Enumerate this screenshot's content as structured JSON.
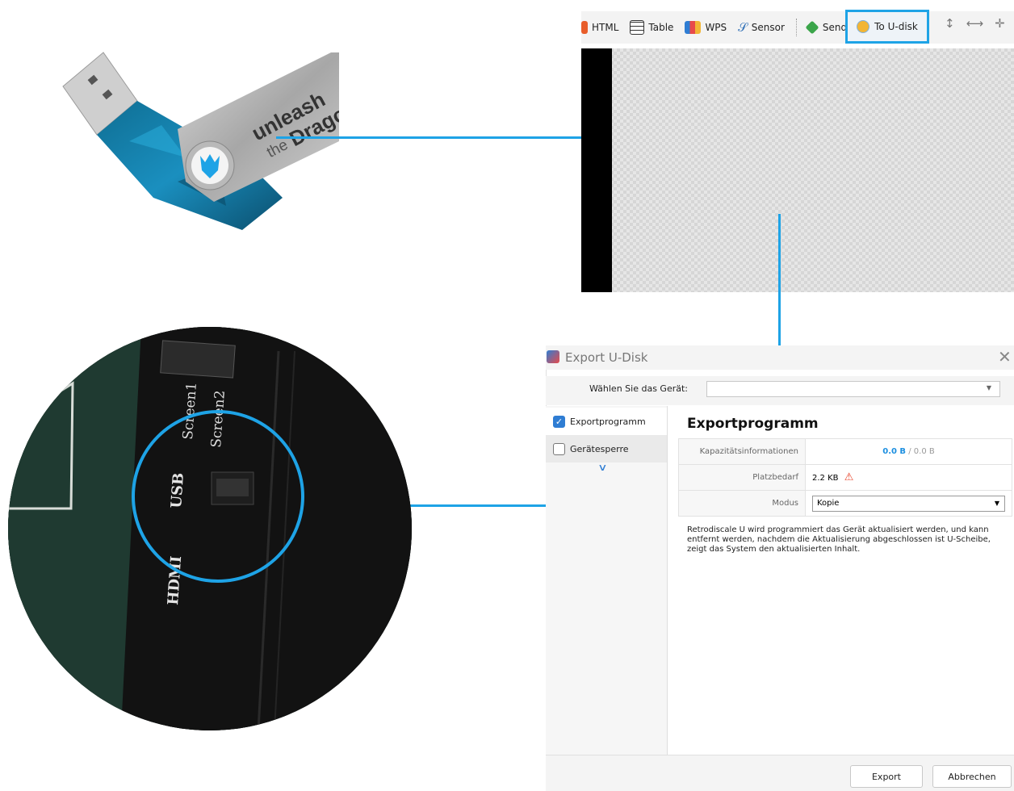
{
  "usb_stick": {
    "brand_line1": "unleash",
    "brand_line2_prefix": "the",
    "brand_line2": "Dragon"
  },
  "toolbar": {
    "items": [
      {
        "label": "HTML",
        "icon": "html-icon"
      },
      {
        "label": "Table",
        "icon": "table-icon"
      },
      {
        "label": "WPS",
        "icon": "wps-icon"
      },
      {
        "label": "Sensor",
        "icon": "sensor-icon"
      },
      {
        "label": "Send",
        "icon": "send-icon"
      }
    ],
    "highlighted": {
      "label": "To U-disk",
      "icon": "udisk-icon"
    },
    "trailing_icons": [
      "vertical-stretch-icon",
      "horizontal-stretch-icon",
      "move-icon"
    ]
  },
  "zoom_photo": {
    "labels": [
      "Screen1",
      "Screen2",
      "USB",
      "HDMI"
    ]
  },
  "dialog": {
    "title": "Export U-Disk",
    "device_label": "Wählen Sie das Gerät:",
    "device_value": "",
    "sidebar": [
      {
        "label": "Exportprogramm",
        "checked": true
      },
      {
        "label": "Gerätesperre",
        "checked": false
      }
    ],
    "section_title": "Exportprogramm",
    "rows": {
      "capacity_label": "Kapazitätsinformationen",
      "capacity_used": "0.0 B",
      "capacity_sep": " / ",
      "capacity_total": "0.0 B",
      "space_label": "Platzbedarf",
      "space_value": "2.2 KB",
      "mode_label": "Modus",
      "mode_value": "Kopie"
    },
    "description": "Retrodiscale U wird programmiert das Gerät aktualisiert werden, und kann entfernt werden, nachdem die Aktualisierung abgeschlossen ist U-Scheibe, zeigt das System den aktualisierten Inhalt.",
    "export_button": "Export",
    "cancel_button": "Abbrechen"
  },
  "colors": {
    "accent": "#1ea3e6",
    "checkbox": "#2f7dd3",
    "capacity_used": "#1c8fe0",
    "warning": "#e8452c"
  }
}
